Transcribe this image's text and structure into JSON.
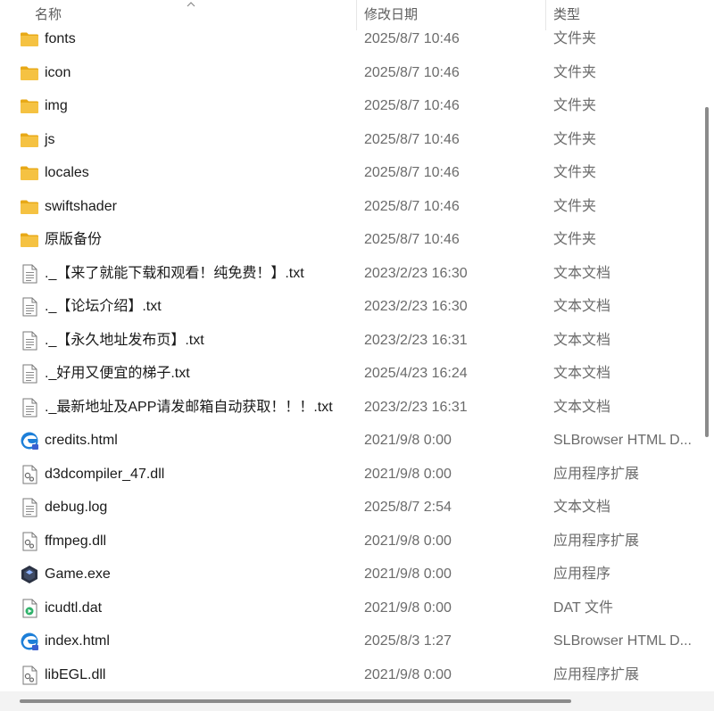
{
  "header": {
    "col_name": "名称",
    "col_date": "修改日期",
    "col_type": "类型",
    "sort_icon": "chevron-up-icon"
  },
  "files": [
    {
      "name": "fonts",
      "date": "2025/8/7 10:46",
      "type": "文件夹",
      "icon": "folder"
    },
    {
      "name": "icon",
      "date": "2025/8/7 10:46",
      "type": "文件夹",
      "icon": "folder"
    },
    {
      "name": "img",
      "date": "2025/8/7 10:46",
      "type": "文件夹",
      "icon": "folder"
    },
    {
      "name": "js",
      "date": "2025/8/7 10:46",
      "type": "文件夹",
      "icon": "folder"
    },
    {
      "name": "locales",
      "date": "2025/8/7 10:46",
      "type": "文件夹",
      "icon": "folder"
    },
    {
      "name": "swiftshader",
      "date": "2025/8/7 10:46",
      "type": "文件夹",
      "icon": "folder"
    },
    {
      "name": "原版备份",
      "date": "2025/8/7 10:46",
      "type": "文件夹",
      "icon": "folder"
    },
    {
      "name": "._【来了就能下载和观看！纯免费！】.txt",
      "date": "2023/2/23 16:30",
      "type": "文本文档",
      "icon": "text-file"
    },
    {
      "name": "._【论坛介绍】.txt",
      "date": "2023/2/23 16:30",
      "type": "文本文档",
      "icon": "text-file"
    },
    {
      "name": "._【永久地址发布页】.txt",
      "date": "2023/2/23 16:31",
      "type": "文本文档",
      "icon": "text-file"
    },
    {
      "name": "._好用又便宜的梯子.txt",
      "date": "2025/4/23 16:24",
      "type": "文本文档",
      "icon": "text-file"
    },
    {
      "name": "._最新地址及APP请发邮箱自动获取！！！.txt",
      "date": "2023/2/23 16:31",
      "type": "文本文档",
      "icon": "text-file"
    },
    {
      "name": "credits.html",
      "date": "2021/9/8 0:00",
      "type": "SLBrowser HTML D...",
      "icon": "browser-html"
    },
    {
      "name": "d3dcompiler_47.dll",
      "date": "2021/9/8 0:00",
      "type": "应用程序扩展",
      "icon": "dll"
    },
    {
      "name": "debug.log",
      "date": "2025/8/7 2:54",
      "type": "文本文档",
      "icon": "text-file"
    },
    {
      "name": "ffmpeg.dll",
      "date": "2021/9/8 0:00",
      "type": "应用程序扩展",
      "icon": "dll"
    },
    {
      "name": "Game.exe",
      "date": "2021/9/8 0:00",
      "type": "应用程序",
      "icon": "game-exe"
    },
    {
      "name": "icudtl.dat",
      "date": "2021/9/8 0:00",
      "type": "DAT 文件",
      "icon": "dat-file"
    },
    {
      "name": "index.html",
      "date": "2025/8/3 1:27",
      "type": "SLBrowser HTML D...",
      "icon": "browser-html"
    },
    {
      "name": "libEGL.dll",
      "date": "2021/9/8 0:00",
      "type": "应用程序扩展",
      "icon": "dll"
    }
  ],
  "colors": {
    "folder": "#f5c242",
    "folder_dark": "#e8a917",
    "browser_blue": "#1d7fd8",
    "scrollbar": "#8b8b8b"
  }
}
